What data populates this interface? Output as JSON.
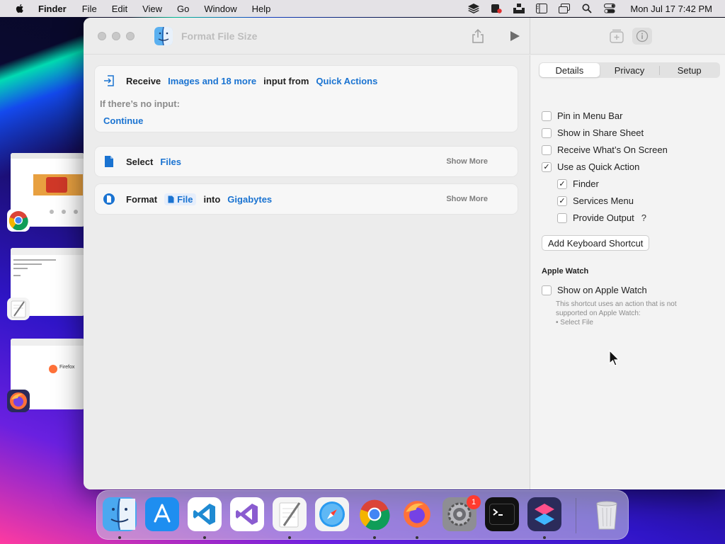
{
  "menubar": {
    "app_name": "Finder",
    "items": [
      "File",
      "Edit",
      "View",
      "Go",
      "Window",
      "Help"
    ],
    "clock": "Mon Jul 17  7:42 PM"
  },
  "window": {
    "title": "Format File Size"
  },
  "workflow": {
    "receive": {
      "keyword": "Receive",
      "types": "Images and 18 more",
      "middle": "input from",
      "source": "Quick Actions",
      "no_input_label": "If there’s no input:",
      "no_input_action": "Continue"
    },
    "select": {
      "keyword": "Select",
      "target": "Files",
      "show_more": "Show More"
    },
    "format": {
      "keyword": "Format",
      "variable": "File",
      "middle": "into",
      "unit": "Gigabytes",
      "show_more": "Show More"
    }
  },
  "sidebar": {
    "tabs": [
      "Details",
      "Privacy",
      "Setup"
    ],
    "active_tab": "Details",
    "options": [
      {
        "label": "Pin in Menu Bar",
        "checked": false
      },
      {
        "label": "Show in Share Sheet",
        "checked": false
      },
      {
        "label": "Receive What’s On Screen",
        "checked": false
      },
      {
        "label": "Use as Quick Action",
        "checked": true
      }
    ],
    "sub_options": [
      {
        "label": "Finder",
        "checked": true
      },
      {
        "label": "Services Menu",
        "checked": true
      },
      {
        "label": "Provide Output",
        "checked": false
      }
    ],
    "help_glyph": "?",
    "keyboard_button": "Add Keyboard Shortcut",
    "watch_section": "Apple Watch",
    "watch_option": {
      "label": "Show on Apple Watch",
      "checked": false
    },
    "watch_note_line1": "This shortcut uses an action that is not",
    "watch_note_line2": "supported on Apple Watch:",
    "watch_note_line3": "• Select File"
  },
  "dock": {
    "apps": [
      "Finder",
      "App Store",
      "Visual Studio Code",
      "Visual Studio",
      "TextEdit",
      "Safari",
      "Chrome",
      "Firefox",
      "System Settings",
      "Terminal",
      "Shortcuts",
      "Trash"
    ],
    "settings_badge": "1"
  },
  "thumbnails": {
    "firefox_label": "Firefox"
  },
  "colors": {
    "accent": "#1a73d1",
    "menubar": "#e4e2e6",
    "badge": "#ff3b30"
  },
  "check_glyph": "✓"
}
